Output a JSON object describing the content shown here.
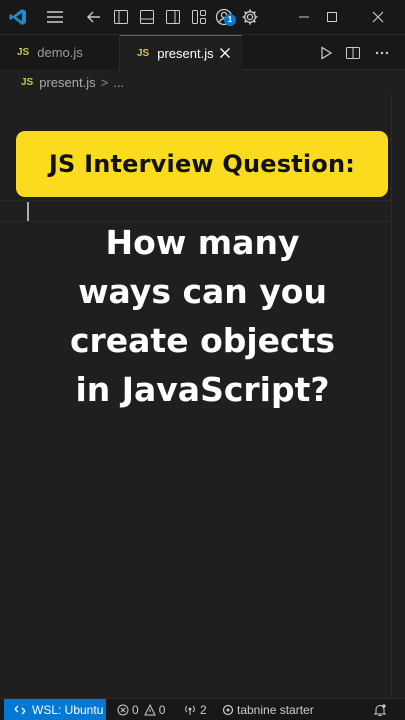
{
  "titlebar": {
    "icons": [
      "vscode-logo-icon",
      "menu-icon",
      "back-arrow-icon",
      "toggle-primary-sidebar-icon",
      "toggle-panel-icon",
      "toggle-secondary-sidebar-icon",
      "customize-layout-icon",
      "account-icon",
      "settings-gear-icon",
      "minimize-icon",
      "maximize-icon",
      "close-icon"
    ],
    "account_badge": "1"
  },
  "tabs": [
    {
      "icon_label": "JS",
      "label": "demo.js",
      "active": false
    },
    {
      "icon_label": "JS",
      "label": "present.js",
      "active": true
    }
  ],
  "breadcrumb": {
    "icon_label": "JS",
    "file": "present.js",
    "separator": ">",
    "rest": "..."
  },
  "overlay": {
    "banner": "JS Interview Question:",
    "question_lines": [
      "How many",
      "ways can you",
      "create objects",
      "in JavaScript?"
    ]
  },
  "statusbar": {
    "remote": "WSL: Ubuntu",
    "errors": "0",
    "warnings": "0",
    "ports": "2",
    "extension": "tabnine starter"
  },
  "colors": {
    "accent": "#0078d4",
    "banner": "#fbdb1d",
    "js_icon": "#cbcb41",
    "background": "#1f1f1f"
  }
}
